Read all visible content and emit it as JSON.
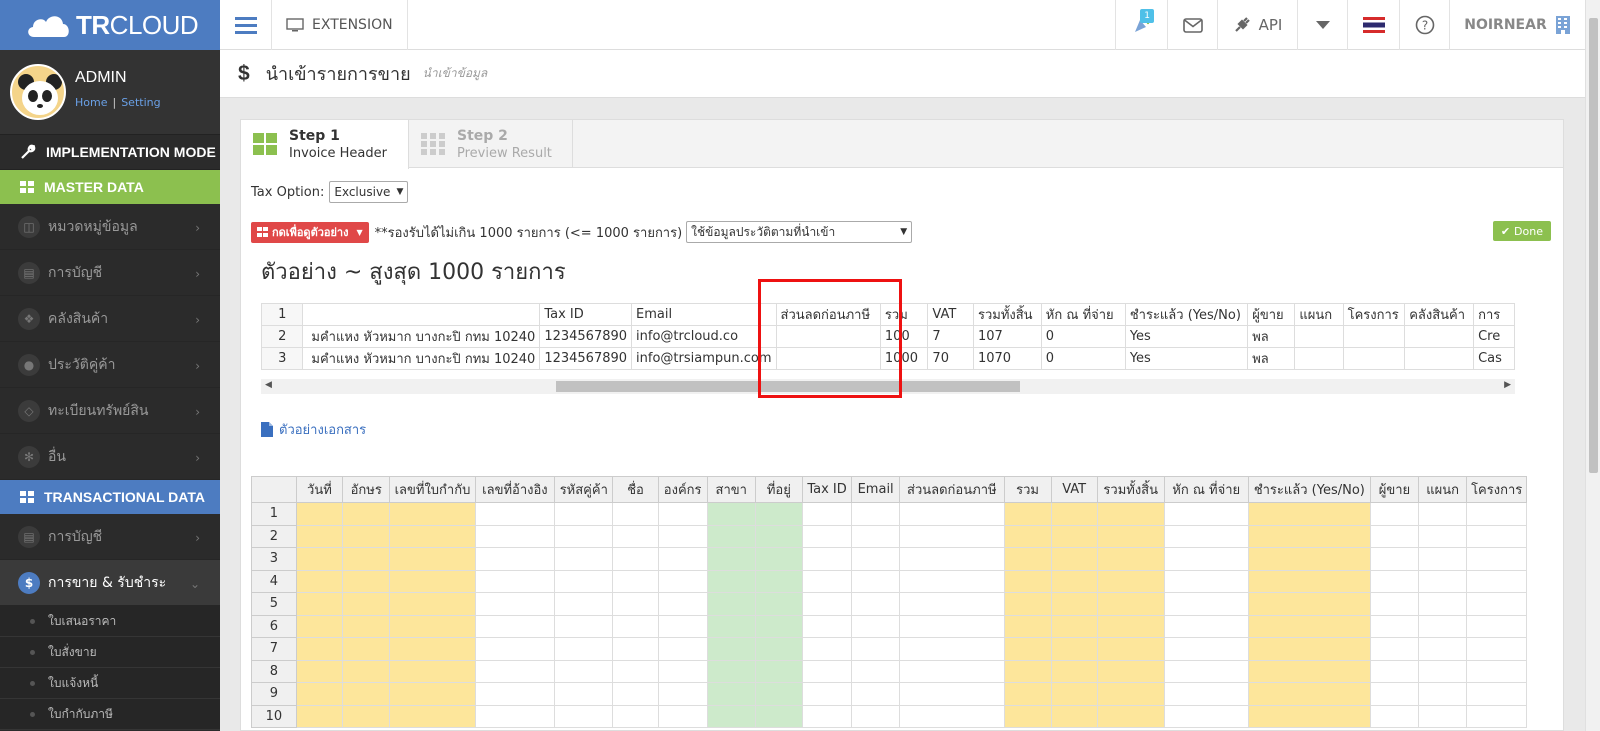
{
  "topbar": {
    "logo_bold": "TR",
    "logo_rest": "CLOUD",
    "extension_label": "EXTENSION",
    "notification_count": "1",
    "api_label": "API",
    "user_label": "NOIRNEAR"
  },
  "sidebar": {
    "admin_name": "ADMIN",
    "home_link": "Home",
    "setting_link": "Setting",
    "implementation_mode": "IMPLEMENTATION MODE",
    "master_data": "MASTER DATA",
    "master_items": [
      {
        "label": "หมวดหมู่ข้อมูล",
        "icon": "columns-icon"
      },
      {
        "label": "การบัญชี",
        "icon": "book-icon"
      },
      {
        "label": "คลังสินค้า",
        "icon": "cubes-icon"
      },
      {
        "label": "ประวัติคู่ค้า",
        "icon": "user-icon"
      },
      {
        "label": "ทะเบียนทรัพย์สิน",
        "icon": "diamond-icon"
      },
      {
        "label": "อื่น",
        "icon": "gear-icon"
      }
    ],
    "transactional_data": "TRANSACTIONAL DATA",
    "trans_items": [
      {
        "label": "การบัญชี",
        "icon": "book-icon"
      },
      {
        "label": "การขาย & รับชำระ",
        "icon": "dollar-icon",
        "active": true
      }
    ],
    "sub_items": [
      "ใบเสนอราคา",
      "ใบสั่งขาย",
      "ใบแจ้งหนี้",
      "ใบกำกับภาษี"
    ]
  },
  "page": {
    "icon": "$",
    "title": "นำเข้ารายการขาย",
    "subtitle": "นำเข้าข้อมูล"
  },
  "steps": [
    {
      "title": "Step 1",
      "subtitle": "Invoice Header",
      "active": true
    },
    {
      "title": "Step 2",
      "subtitle": "Preview Result",
      "active": false
    }
  ],
  "tax_option": {
    "label": "Tax Option:",
    "value": "Exclusive"
  },
  "controls": {
    "sample_button": "กดเพื่อดูตัวอย่าง",
    "limit_note": "**รองรับได้ไม่เกิน 1000 รายการ (<= 1000 รายการ)",
    "history_select": "ใช้ข้อมูลประวัติตามที่นำเข้า",
    "done_button": "Done"
  },
  "sample": {
    "title": "ตัวอย่าง ~ สูงสุด 1000 รายการ",
    "rows": [
      [
        "1",
        "",
        "Tax ID",
        "Email",
        "ส่วนลดก่อนภาษี",
        "รวม",
        "VAT",
        "รวมทั้งสิ้น",
        "หัก ณ ที่จ่าย",
        "ชำระแล้ว (Yes/No)",
        "ผู้ขาย",
        "แผนก",
        "โครงการ",
        "คลังสินค้า",
        "การ"
      ],
      [
        "2",
        "มคำแหง หัวหมาก บางกะปิ กทม 10240",
        "1234567890",
        "info@trcloud.co",
        "",
        "100",
        "7",
        "107",
        "0",
        "Yes",
        "พล",
        "",
        "",
        "",
        "Cre"
      ],
      [
        "3",
        "มคำแหง หัวหมาก บางกะปิ กทม 10240",
        "1234567890",
        "info@trsiampun.com",
        "",
        "1000",
        "70",
        "1070",
        "0",
        "Yes",
        "พล",
        "",
        "",
        "",
        "Cas"
      ]
    ]
  },
  "doc_link": "ตัวอย่างเอกสาร",
  "import_grid": {
    "headers": [
      "",
      "วันที่",
      "อักษร",
      "เลขที่ใบกำกับ",
      "เลขที่อ้างอิง",
      "รหัสคู่ค้า",
      "ชื่อ",
      "องค์กร",
      "สาขา",
      "ที่อยู่",
      "Tax ID",
      "Email",
      "ส่วนลดก่อนภาษี",
      "รวม",
      "VAT",
      "รวมทั้งสิ้น",
      "หัก ณ ที่จ่าย",
      "ชำระแล้ว (Yes/No)",
      "ผู้ขาย",
      "แผนก",
      "โครงการ"
    ],
    "column_fill": [
      "rn",
      "y",
      "y",
      "y",
      "w",
      "w",
      "w",
      "w",
      "g",
      "g",
      "w",
      "w",
      "w",
      "y",
      "y",
      "y",
      "w",
      "y",
      "w",
      "w",
      "w"
    ],
    "row_numbers": [
      "1",
      "2",
      "3",
      "4",
      "5",
      "6",
      "7",
      "8",
      "9",
      "10"
    ]
  },
  "colors": {
    "brand_blue": "#4d7cc1",
    "master_green": "#8cc04f",
    "required_yellow": "#fde69b",
    "branch_green": "#cdeacb",
    "highlight_red": "#ee1111"
  }
}
